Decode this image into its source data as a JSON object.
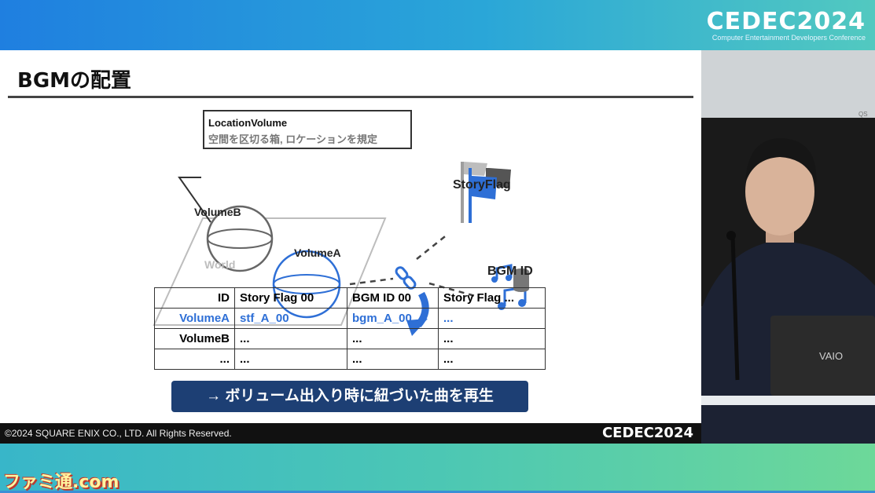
{
  "header": {
    "event_logo": "CEDEC2024",
    "event_subtitle": "Computer Entertainment Developers Conference"
  },
  "slide": {
    "title": "BGMの配置",
    "callout": {
      "title": "LocationVolume",
      "description": "空間を区切る箱, ロケーションを規定"
    },
    "diagram_labels": {
      "volume_b": "VolumeB",
      "volume_a": "VolumeA",
      "world": "World",
      "story_flag": "StoryFlag",
      "bgm_id": "BGM ID"
    },
    "table": {
      "headers": [
        "ID",
        "Story Flag 00",
        "BGM ID 00",
        "Story Flag ..."
      ],
      "rows": [
        [
          "VolumeA",
          "stf_A_00",
          "bgm_A_00",
          "..."
        ],
        [
          "VolumeB",
          "...",
          "...",
          "..."
        ],
        [
          "...",
          "...",
          "...",
          "..."
        ]
      ]
    },
    "result_banner": "→ ボリューム出入り時に紐づいた曲を再生",
    "footer_copyright": "©2024 SQUARE ENIX CO., LTD. All Rights Reserved.",
    "footer_logo": "CEDEC2024"
  },
  "camera": {
    "laptop_brand": "VAIO",
    "corner_mark": "QS"
  },
  "watermark": "ファミ通.com",
  "colors": {
    "accent_blue": "#2e6fd6",
    "result_banner_bg": "#1d3f74",
    "header_gradient_start": "#1f7fe0",
    "footer_gradient_end": "#6dd899"
  }
}
